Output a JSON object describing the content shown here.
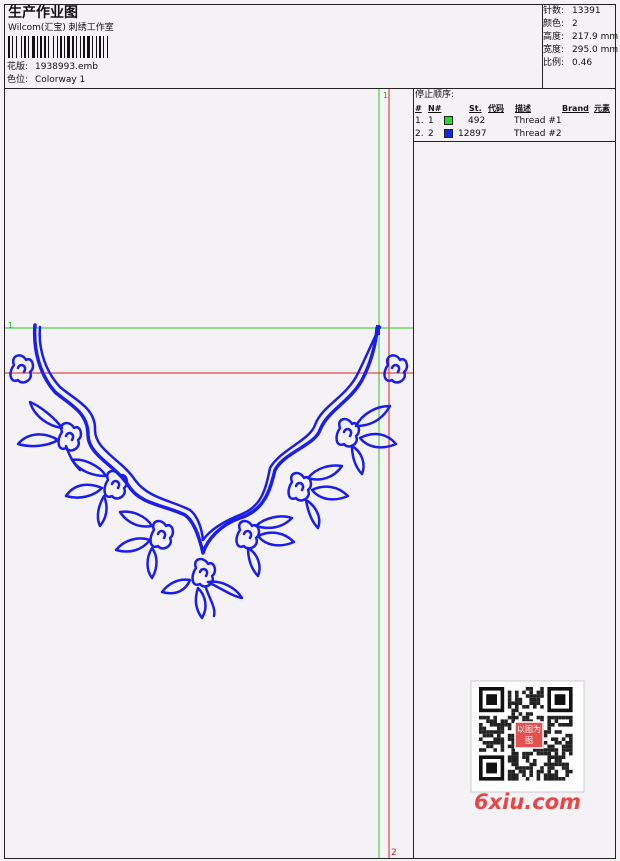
{
  "header": {
    "title": "生产作业图",
    "company": "Wilcom(汇宝) 刺绣工作室",
    "design_label": "花版:",
    "design_file": "1938993.emb",
    "colorway_label": "色位:",
    "colorway": "Colorway 1"
  },
  "stats": [
    {
      "label": "针数:",
      "value": "13391"
    },
    {
      "label": "颜色:",
      "value": "2"
    },
    {
      "label": "高度:",
      "value": "217.9 mm"
    },
    {
      "label": "宽度:",
      "value": "295.0 mm"
    },
    {
      "label": "比例:",
      "value": "0.46"
    }
  ],
  "sequence": {
    "title": "停止顺序:",
    "headers": {
      "num": "#",
      "no": "N#",
      "st": "St.",
      "code": "代码",
      "desc": "描述",
      "brand": "Brand",
      "elem": "元素"
    },
    "rows": [
      {
        "num": "1.",
        "no": "1",
        "color": "#22dd22",
        "stitches": "492",
        "desc": "Thread #1"
      },
      {
        "num": "2.",
        "no": "2",
        "color": "#1428e0",
        "stitches": "12897",
        "desc": "Thread #2"
      }
    ]
  },
  "guides": {
    "top_marker": "1",
    "left_marker": "1",
    "bottom_marker": "2"
  },
  "watermark": {
    "site": "6xiu.com",
    "badge": "以图为图"
  },
  "colors": {
    "stitch": "#1a1ee8",
    "guide_green": "#22cc22",
    "guide_red": "#dd2222"
  }
}
